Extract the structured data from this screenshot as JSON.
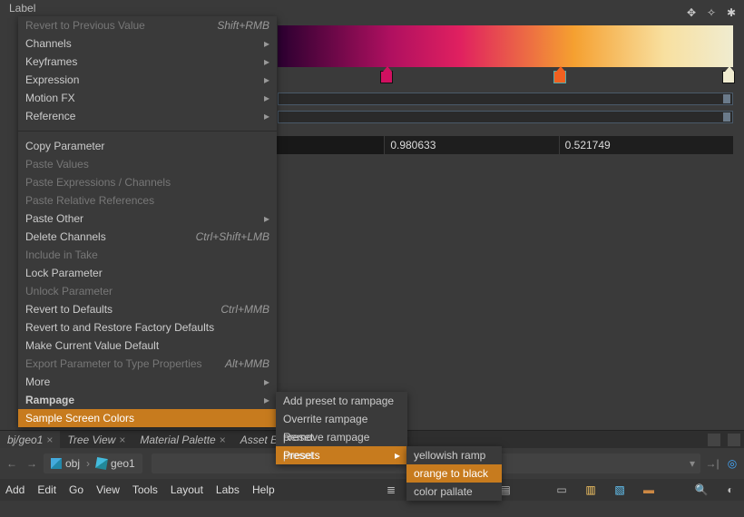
{
  "header": {
    "label": "Label"
  },
  "ramp": {
    "handles": [
      {
        "pos_pct": 24,
        "color": "pink"
      },
      {
        "pos_pct": 62,
        "color": "orange"
      },
      {
        "pos_pct": 99,
        "color": "beige"
      }
    ]
  },
  "values": {
    "cell_a": "",
    "cell_b": "0.980633",
    "cell_c": "0.521749"
  },
  "context_menu": {
    "items": [
      {
        "label": "Revert to Previous Value",
        "hotkey": "Shift+RMB",
        "disabled": true
      },
      {
        "label": "Channels",
        "submenu": true
      },
      {
        "label": "Keyframes",
        "submenu": true
      },
      {
        "label": "Expression",
        "submenu": true
      },
      {
        "label": "Motion FX",
        "submenu": true
      },
      {
        "label": "Reference",
        "submenu": true
      },
      {
        "sep": true
      },
      {
        "label": "Copy Parameter"
      },
      {
        "label": "Paste Values",
        "disabled": true
      },
      {
        "label": "Paste Expressions / Channels",
        "disabled": true
      },
      {
        "label": "Paste Relative References",
        "disabled": true
      },
      {
        "label": "Paste Other",
        "submenu": true
      },
      {
        "label": "Delete Channels",
        "hotkey": "Ctrl+Shift+LMB"
      },
      {
        "label": "Include in Take",
        "disabled": true
      },
      {
        "label": "Lock Parameter"
      },
      {
        "label": "Unlock Parameter",
        "disabled": true
      },
      {
        "label": "Revert to Defaults",
        "hotkey": "Ctrl+MMB"
      },
      {
        "label": "Revert to and Restore Factory Defaults"
      },
      {
        "label": "Make Current Value Default"
      },
      {
        "label": "Export Parameter to Type Properties",
        "hotkey": "Alt+MMB",
        "disabled": true
      },
      {
        "label": "More",
        "submenu": true
      },
      {
        "label": "Rampage",
        "submenu": true,
        "bold": true
      },
      {
        "label": "Sample Screen Colors",
        "hover": true
      }
    ]
  },
  "rampage_submenu": {
    "items": [
      {
        "label": "Add preset to rampage"
      },
      {
        "label": "Overrite rampage preset"
      },
      {
        "label": "Remove rampage preset"
      },
      {
        "label": "Presets",
        "submenu": true,
        "hover": true
      }
    ]
  },
  "presets_submenu": {
    "items": [
      {
        "label": "yellowish ramp"
      },
      {
        "label": "orange to black",
        "hover": true
      },
      {
        "label": "color pallate"
      }
    ]
  },
  "tabs": [
    {
      "label": "bj/geo1",
      "active": true
    },
    {
      "label": "Tree View"
    },
    {
      "label": "Material Palette"
    },
    {
      "label": "Asset Brows"
    }
  ],
  "breadcrumb": {
    "seg1": "obj",
    "seg2": "geo1"
  },
  "menubar": [
    "Add",
    "Edit",
    "Go",
    "View",
    "Tools",
    "Layout",
    "Labs",
    "Help"
  ]
}
